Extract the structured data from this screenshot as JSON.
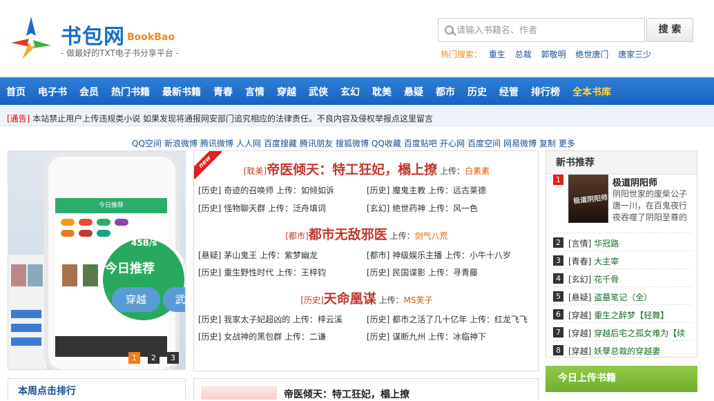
{
  "header": {
    "logo_cn": "书包网",
    "logo_en": "BookBao",
    "slogan": "- 做最好的TXT电子书分享平台 -",
    "search_placeholder": "请输入书籍名、作者",
    "search_button": "搜 索",
    "hot_label": "热门搜索：",
    "hot_terms": [
      "重生",
      "总裁",
      "郭敬明",
      "绝世唐门",
      "唐家三少"
    ]
  },
  "nav": {
    "items": [
      "首页",
      "电子书",
      "会员",
      "热门书籍",
      "最新书籍",
      "青春",
      "言情",
      "穿越",
      "武侠",
      "玄幻",
      "耽美",
      "悬疑",
      "都市",
      "历史",
      "经管",
      "排行榜"
    ],
    "gold_item": "全本书库"
  },
  "notice": {
    "tag": "[通告]",
    "text": " 本站禁止用户上传违规类小说 如果发现将通报网安部门追究相应的法律责任。不良内容及侵权举报点这里留言"
  },
  "share_links": [
    "QQ空间",
    "新浪微博",
    "腾讯微博",
    "人人网",
    "百度搜藏",
    "腾讯朋友",
    "搜狐微博",
    "QQ收藏",
    "百度贴吧",
    "开心网",
    "百度空间",
    "网易微博",
    "复制",
    "更多"
  ],
  "slider": {
    "phone_bar": "今日推荐",
    "circle_title": "今日推荐",
    "speed": "45B/s",
    "chip_1": "穿越",
    "chip_2": "武",
    "dots": [
      "1",
      "2",
      "3"
    ]
  },
  "center": {
    "ribbon": "new",
    "headlines": [
      {
        "cat": "[耽美]",
        "title": "帝医倾天：特工狂妃，榻上撩",
        "up": " 上传：",
        "author": "白素素"
      },
      {
        "cat": "[都市]",
        "title": "都市无敌邪医",
        "up": " 上传：",
        "author": "剑气八荒"
      },
      {
        "cat": "[历史]",
        "title": "天命凰谋",
        "up": " 上传：",
        "author": "MS芙子"
      }
    ],
    "items": [
      {
        "cat": "[历史]",
        "name": "奇迹的召唤师",
        "uploader": "如倾如诉"
      },
      {
        "cat": "[历史]",
        "name": "魔鬼主教",
        "uploader": "远古莱德"
      },
      {
        "cat": "[历史]",
        "name": "怪物聊天群",
        "uploader": "泛舟填词"
      },
      {
        "cat": "[玄幻]",
        "name": "绝世药神",
        "uploader": "风一色"
      },
      {
        "cat": "[悬疑]",
        "name": "茅山鬼王",
        "uploader": "紫梦幽龙"
      },
      {
        "cat": "[都市]",
        "name": "神级娱乐主播",
        "uploader": "小牛十八岁"
      },
      {
        "cat": "[历史]",
        "name": "重生野性时代",
        "uploader": "王梓钧"
      },
      {
        "cat": "[历史]",
        "name": "民国谍影",
        "uploader": "寻青藤"
      },
      {
        "cat": "[历史]",
        "name": "我家太子妃超凶的",
        "uploader": "梓云溪"
      },
      {
        "cat": "[历史]",
        "name": "都市之活了几十亿年",
        "uploader": "红龙飞飞"
      },
      {
        "cat": "[历史]",
        "name": "女战神的黑包群",
        "uploader": "二谦"
      },
      {
        "cat": "[历史]",
        "name": "谋断九州",
        "uploader": "冰临神下"
      }
    ],
    "upload_word": " 上传："
  },
  "right": {
    "title": "新书推荐",
    "featured": {
      "num": "1",
      "title": "极道阴阳师",
      "desc": "阴阳世家的废柴公子唐一川，在百鬼夜行夜吞噬了阴阳至尊的",
      "cover_text": "极道阴阳师"
    },
    "ranks": [
      {
        "num": "2",
        "cat": "[言情]",
        "name": " 华冠路"
      },
      {
        "num": "3",
        "cat": "[青春]",
        "name": " 大主宰"
      },
      {
        "num": "4",
        "cat": "[玄幻]",
        "name": " 花千骨"
      },
      {
        "num": "5",
        "cat": "[悬疑]",
        "name": " 盗墓笔记（全）"
      },
      {
        "num": "6",
        "cat": "[穿越]",
        "name": " 重生之醉梦【轻舞】"
      },
      {
        "num": "7",
        "cat": "[穿越]",
        "name": " 穿越后宅之孤女难为【续"
      },
      {
        "num": "8",
        "cat": "[穿越]",
        "name": " 妖孽总裁的穿越妻"
      }
    ],
    "upload_title": "今日上传书籍"
  },
  "bottom": {
    "week_title": "本周点击排行",
    "center_title": "帝医倾天：特工狂妃，榻上撩"
  },
  "colors": {
    "nav": "#1d6cc8",
    "accent_red": "#c0392b",
    "upload_green": "#7ab636"
  }
}
